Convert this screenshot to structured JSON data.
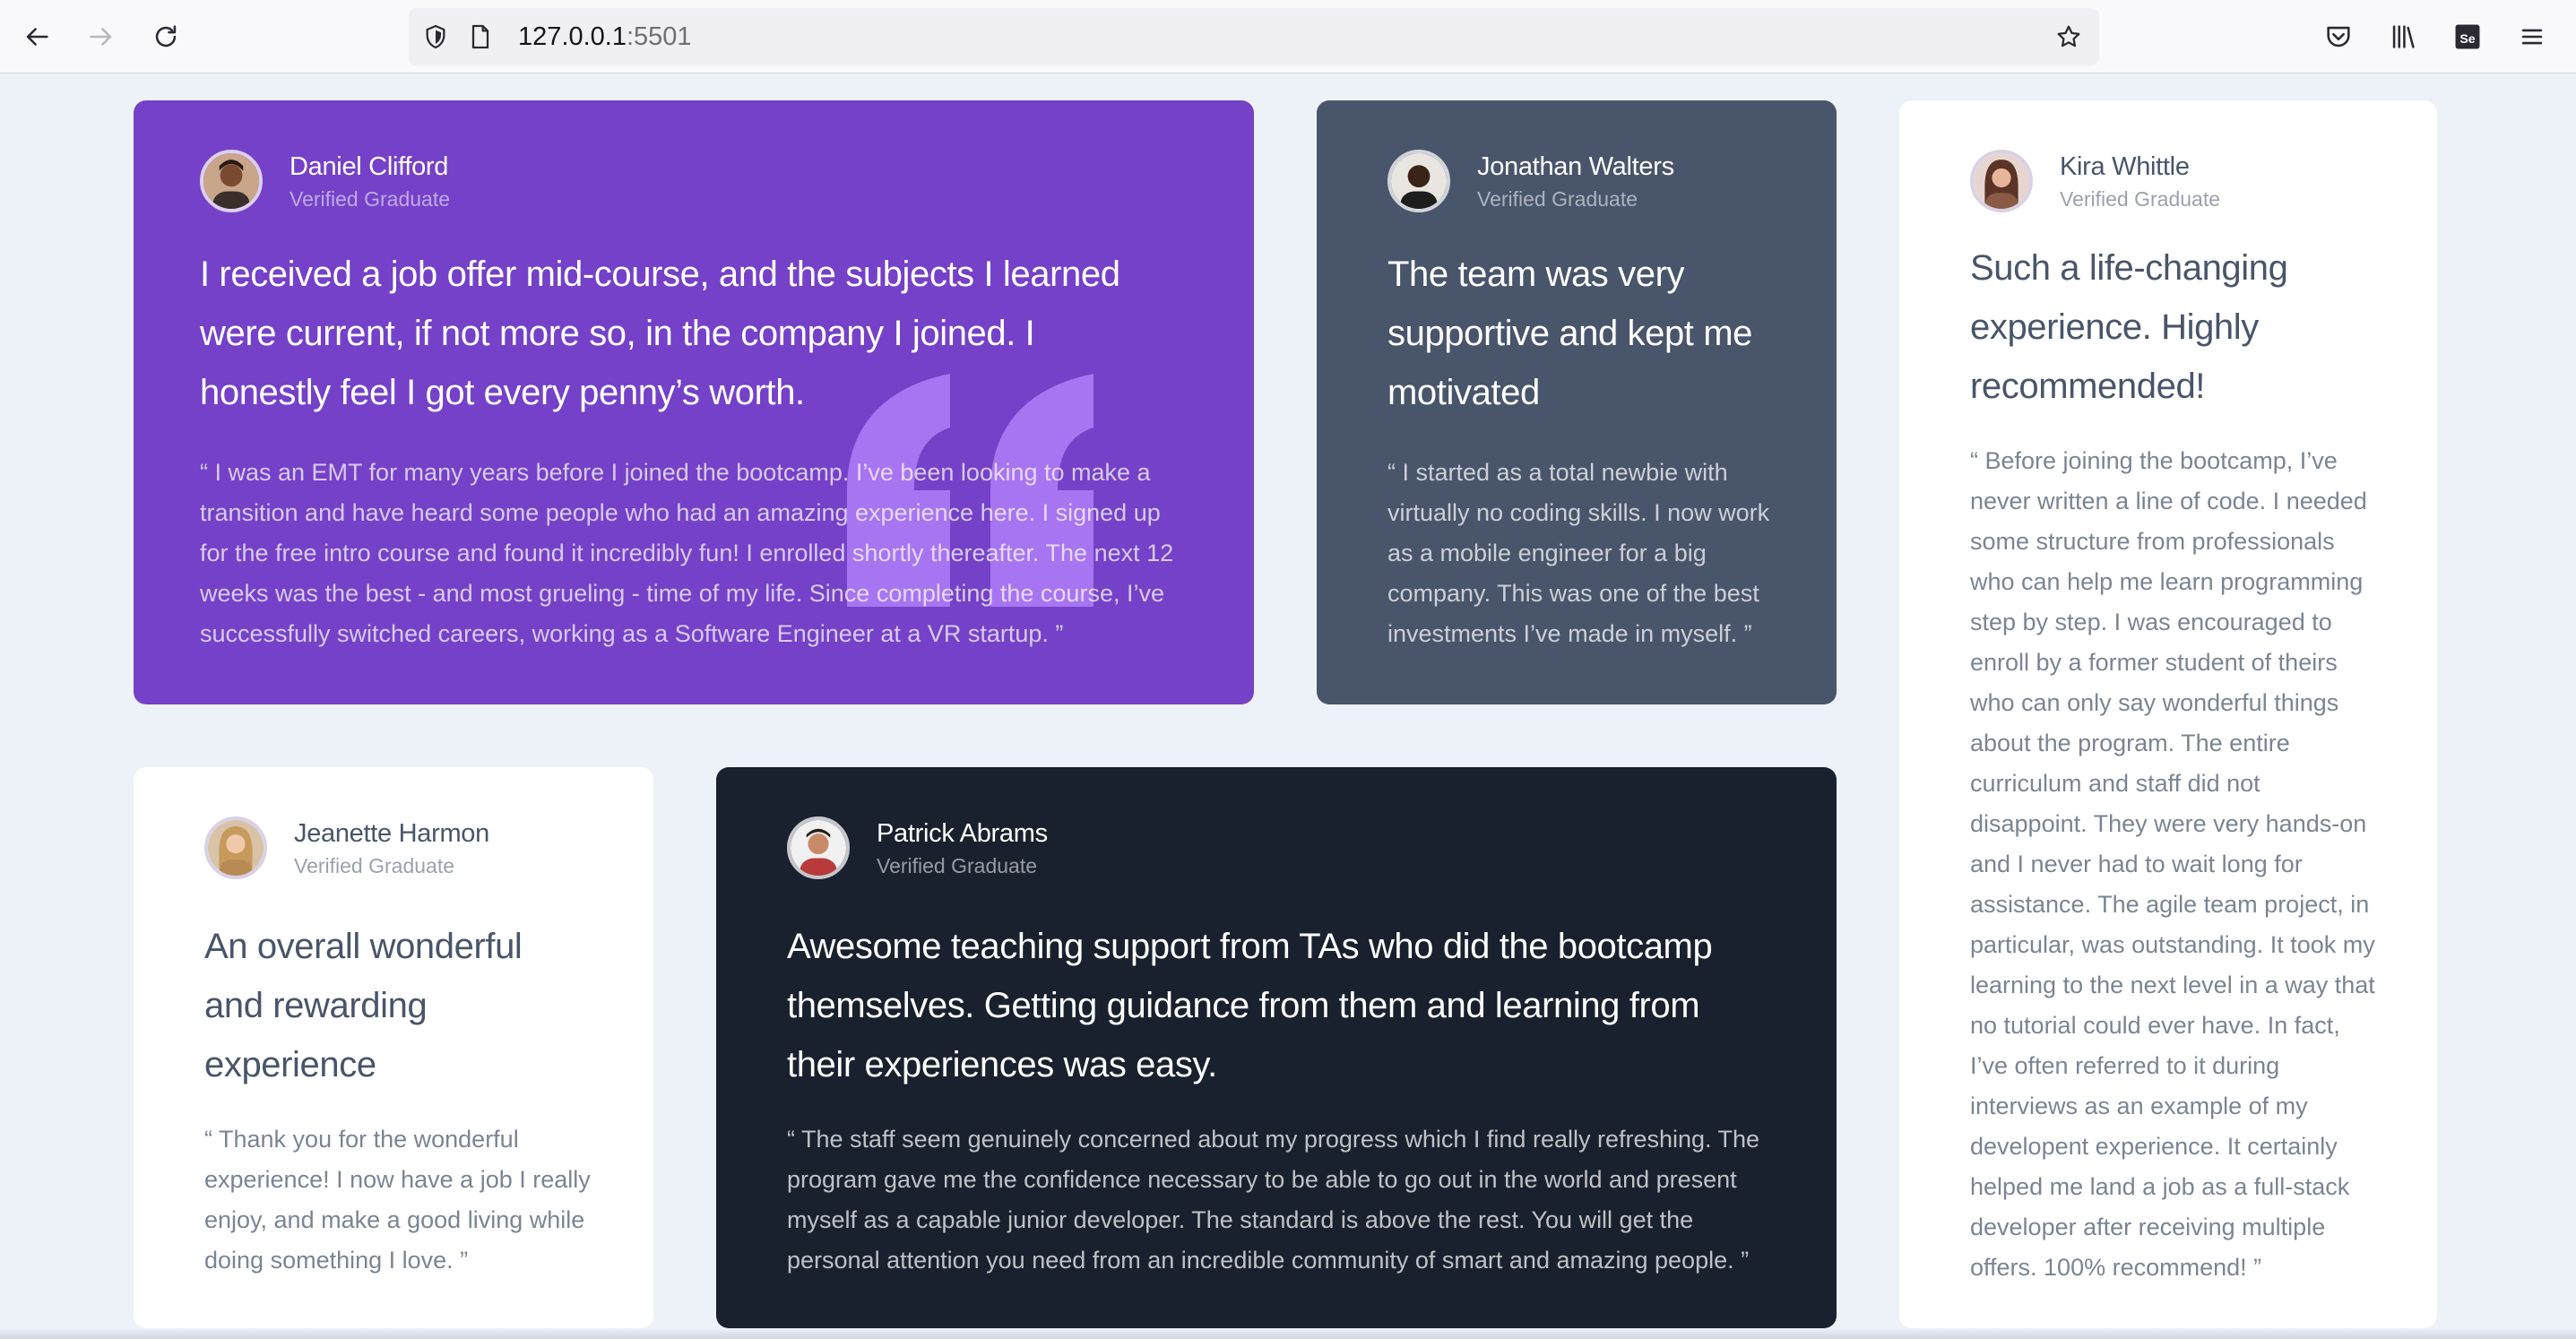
{
  "browser": {
    "url_host": "127.0.0.1",
    "url_port": ":5501"
  },
  "testimonials": [
    {
      "name": "Daniel Clifford",
      "role": "Verified Graduate",
      "headline": "I received a job offer mid-course, and the subjects I learned were current, if not more so, in the company I joined. I honestly feel I got every penny’s worth.",
      "body": "“ I was an EMT for many years before I joined the bootcamp. I’ve been looking to make a transition and have heard some people who had an amazing experience here. I signed up for the free intro course and found it incredibly fun! I enrolled shortly thereafter. The next 12 weeks was the best - and most grueling - time of my life. Since completing the course, I’ve successfully switched careers, working as a Software Engineer at a VR startup. ”",
      "theme": "#7541c8"
    },
    {
      "name": "Jonathan Walters",
      "role": "Verified Graduate",
      "headline": "The team was very supportive and kept me motivated",
      "body": "“ I started as a total newbie with virtually no coding skills. I now work as a mobile engineer for a big company. This was one of the best investments I’ve made in myself. ”",
      "theme": "#48556a"
    },
    {
      "name": "Jeanette Harmon",
      "role": "Verified Graduate",
      "headline": "An overall wonderful and rewarding experience",
      "body": "“ Thank you for the wonderful experience! I now have a job I really enjoy, and make a good living while doing something I love. ”",
      "theme": "#ffffff"
    },
    {
      "name": "Patrick Abrams",
      "role": "Verified Graduate",
      "headline": "Awesome teaching support from TAs who did the bootcamp themselves. Getting guidance from them and learning from their experiences was easy.",
      "body": "“ The staff seem genuinely concerned about my progress which I find really refreshing. The program gave me the confidence necessary to be able to go out in the world and present myself as a capable junior developer. The standard is above the rest. You will get the personal attention you need from an incredible community of smart and amazing people. ”",
      "theme": "#19212e"
    },
    {
      "name": "Kira Whittle",
      "role": "Verified Graduate",
      "headline": "Such a life-changing experience. Highly recommended!",
      "body": "“ Before joining the bootcamp, I’ve never written a line of code. I needed some structure from professionals who can help me learn programming step by step. I was encouraged to enroll by a former student of theirs who can only say wonderful things about the program. The entire curriculum and staff did not disappoint. They were very hands-on and I never had to wait long for assistance. The agile team project, in particular, was outstanding. It took my learning to the next level in a way that no tutorial could ever have. In fact, I’ve often referred to it during interviews as an example of my developent experience. It certainly helped me land a job as a full-stack developer after receiving multiple offers. 100% recommend! ”",
      "theme": "#ffffff"
    }
  ]
}
